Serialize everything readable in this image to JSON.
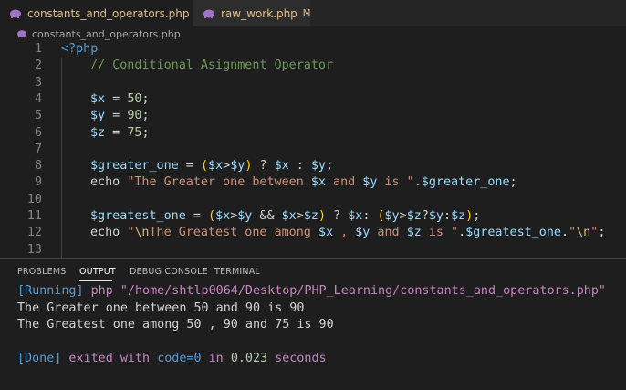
{
  "tabs": [
    {
      "label": "constants_and_operators.php",
      "status": "U",
      "active": true,
      "close": "✕"
    },
    {
      "label": "raw_work.php",
      "status": "M",
      "active": false
    }
  ],
  "breadcrumb": "constants_and_operators.php",
  "editor": {
    "lines": [
      {
        "n": "1"
      },
      {
        "n": "2"
      },
      {
        "n": "3"
      },
      {
        "n": "4"
      },
      {
        "n": "5"
      },
      {
        "n": "6"
      },
      {
        "n": "7"
      },
      {
        "n": "8"
      },
      {
        "n": "9"
      },
      {
        "n": "10"
      },
      {
        "n": "11"
      },
      {
        "n": "12"
      },
      {
        "n": "13"
      }
    ],
    "code": {
      "l1": "<?php",
      "l2": "// Conditional Asignment Operator",
      "l4": {
        "var": "$x",
        "op": " = ",
        "num": "50",
        "end": ";"
      },
      "l5": {
        "var": "$y",
        "op": " = ",
        "num": "90",
        "end": ";"
      },
      "l6": {
        "var": "$z",
        "op": " = ",
        "num": "75",
        "end": ";"
      },
      "l8": {
        "a": "$greater_one",
        " b": " = ",
        "p1": "(",
        "c": "$x",
        ">": ">",
        "d": "$y",
        "p2": ")",
        "e": " ? ",
        "f": "$x",
        "g": " : ",
        "h": "$y",
        "i": ";"
      },
      "l9": {
        "kw": "echo ",
        "str": "\"The Greater one between ",
        "v1": "$x",
        "s2": " and ",
        "v2": "$y",
        "s3": " is \"",
        "dot": ".",
        "v3": "$greater_one",
        "end": ";"
      },
      "l11": {
        "a": "$greatest_one",
        " b": " = ",
        "p1": "(",
        "c": "$x",
        ">": ">",
        "d": "$y",
        "amp": " && ",
        "e": "$x",
        "gt": ">",
        "f": "$z",
        "p2": ")",
        "q": " ? ",
        "g": "$x",
        "col": ": ",
        "p3": "(",
        "h": "$y",
        "gt2": ">",
        "i": "$z",
        "q2": "?",
        "j": "$y",
        "col2": ":",
        "k": "$z",
        "p4": ")",
        "end": ";"
      },
      "l12": {
        "kw": "echo ",
        "s1": "\"",
        "esc": "\\n",
        "s1b": "The Greatest one among ",
        "v1": "$x",
        "s2": " , ",
        "v2": "$y",
        "s3": " and ",
        "v3": "$z",
        "s4": " is \"",
        "dot": ".",
        "v4": "$greatest_one",
        "dot2": ".",
        "s5": "\"",
        "esc2": "\\n",
        "s6": "\"",
        "end": ";"
      }
    }
  },
  "panel": {
    "tabs": [
      "PROBLEMS",
      "OUTPUT",
      "DEBUG CONSOLE",
      "TERMINAL"
    ],
    "active": "OUTPUT",
    "output": {
      "running_tag": "[Running]",
      "running_cmd": " php \"/home/shtlp0064/Desktop/PHP_Learning/constants_and_operators.php\"",
      "line1": "The Greater one between 50 and 90 is 90",
      "line2": "The Greatest one among 50 , 90 and 75 is 90",
      "done_tag": "[Done]",
      "done_a": " exited with ",
      "done_code": "code=0",
      "done_b": " in ",
      "done_time": "0.023",
      "done_c": " seconds"
    }
  },
  "colors": {
    "accent": "#569cd6",
    "modified": "#e2c08d",
    "purple": "#c586c0"
  }
}
